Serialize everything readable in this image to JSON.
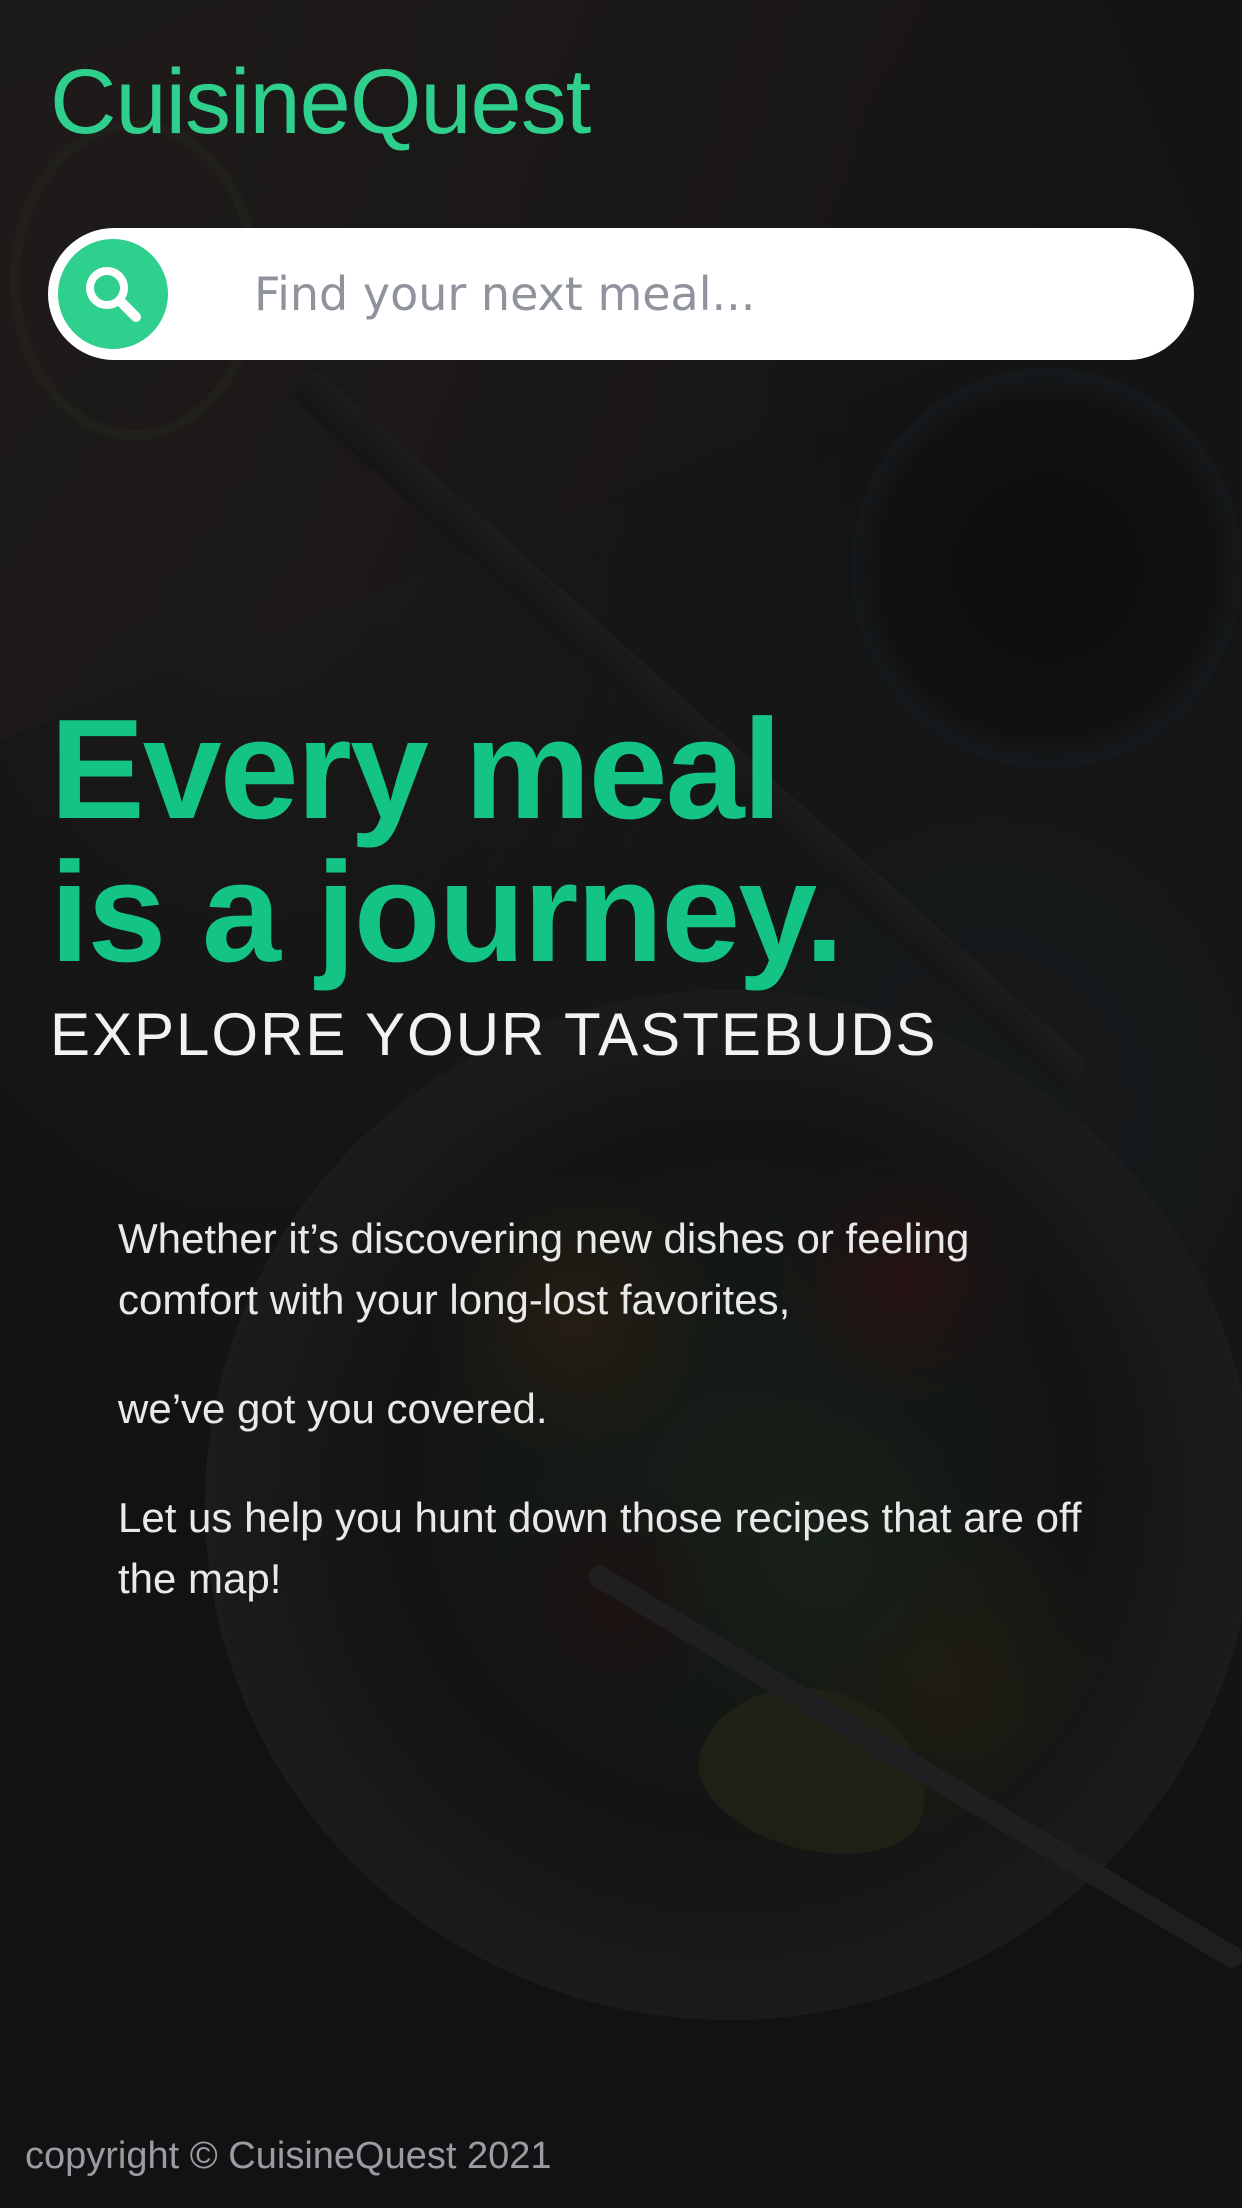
{
  "brand": {
    "logo_text": "CuisineQuest",
    "accent_color": "#2fcf8e",
    "headline_color": "#14c484"
  },
  "search": {
    "placeholder": "Find your next meal...",
    "value": "",
    "button_icon": "search-icon"
  },
  "hero": {
    "headline_line1": "Every meal",
    "headline_line2": "is a journey.",
    "subheading": "EXPLORE YOUR TASTEBUDS"
  },
  "intro": {
    "paragraphs": [
      "Whether it’s discovering new dishes or feeling comfort with your long-lost favorites,",
      "we’ve got you covered.",
      "Let us help you hunt down those recipes that are off the map!"
    ]
  },
  "footer": {
    "copyright": "copyright © CuisineQuest 2021"
  }
}
